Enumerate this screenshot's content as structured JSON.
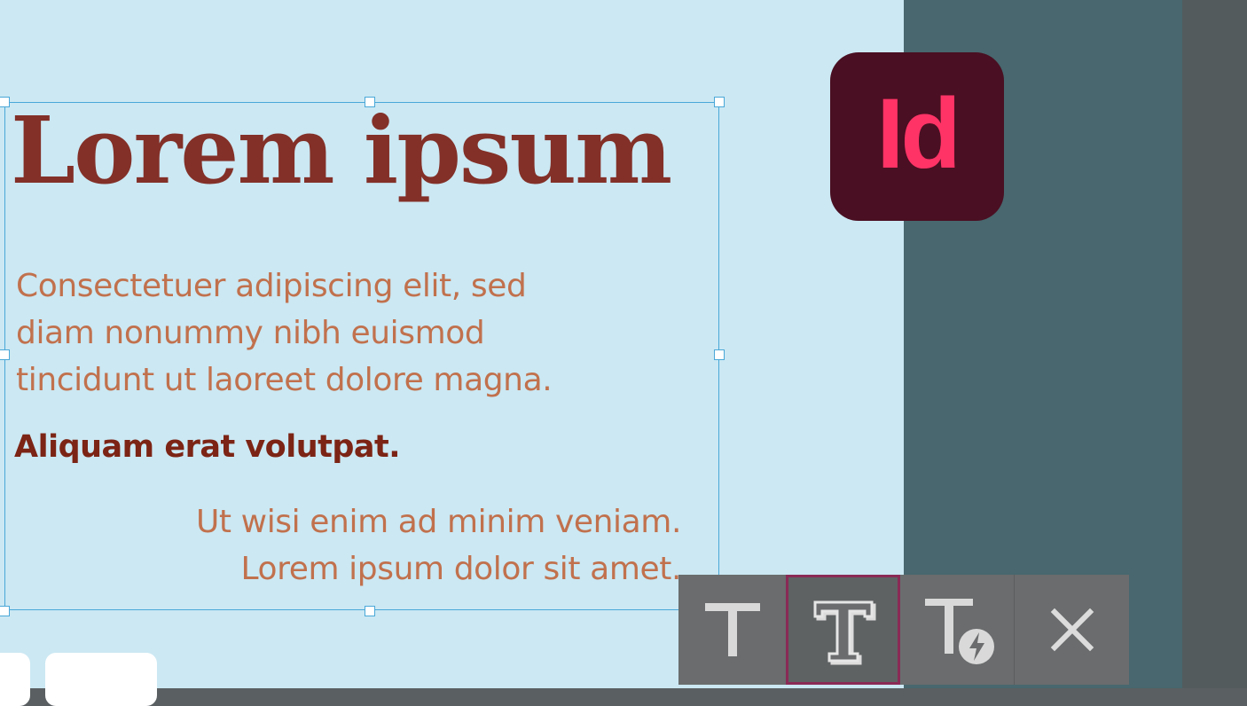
{
  "text_frame": {
    "headline": "Lorem ipsum",
    "body_lines": [
      "Consectetuer adipiscing elit, sed",
      "diam nonummy nibh euismod",
      "tincidunt ut laoreet dolore magna."
    ],
    "emphasis": "Aliquam erat volutpat.",
    "closing_lines": [
      "Ut wisi enim ad minim veniam.",
      "Lorem ipsum dolor sit amet."
    ]
  },
  "app_logo": {
    "text": "Id",
    "icon": "indesign-logo",
    "background_color": "#4a0f22",
    "text_color": "#ff3366"
  },
  "toolbar": {
    "tools": [
      {
        "icon": "text-icon",
        "selected": false
      },
      {
        "icon": "text-outline-icon",
        "selected": true
      },
      {
        "icon": "text-quick-action-icon",
        "selected": false
      },
      {
        "icon": "close-icon",
        "selected": false
      }
    ],
    "selected_border_color": "#8a2a55"
  },
  "colors": {
    "canvas": "#cbe8f3",
    "pasteboard": "#48676e",
    "headline": "#833028",
    "body": "#c1714d",
    "emphasis": "#7c2415",
    "selection": "#4aa8d8"
  }
}
